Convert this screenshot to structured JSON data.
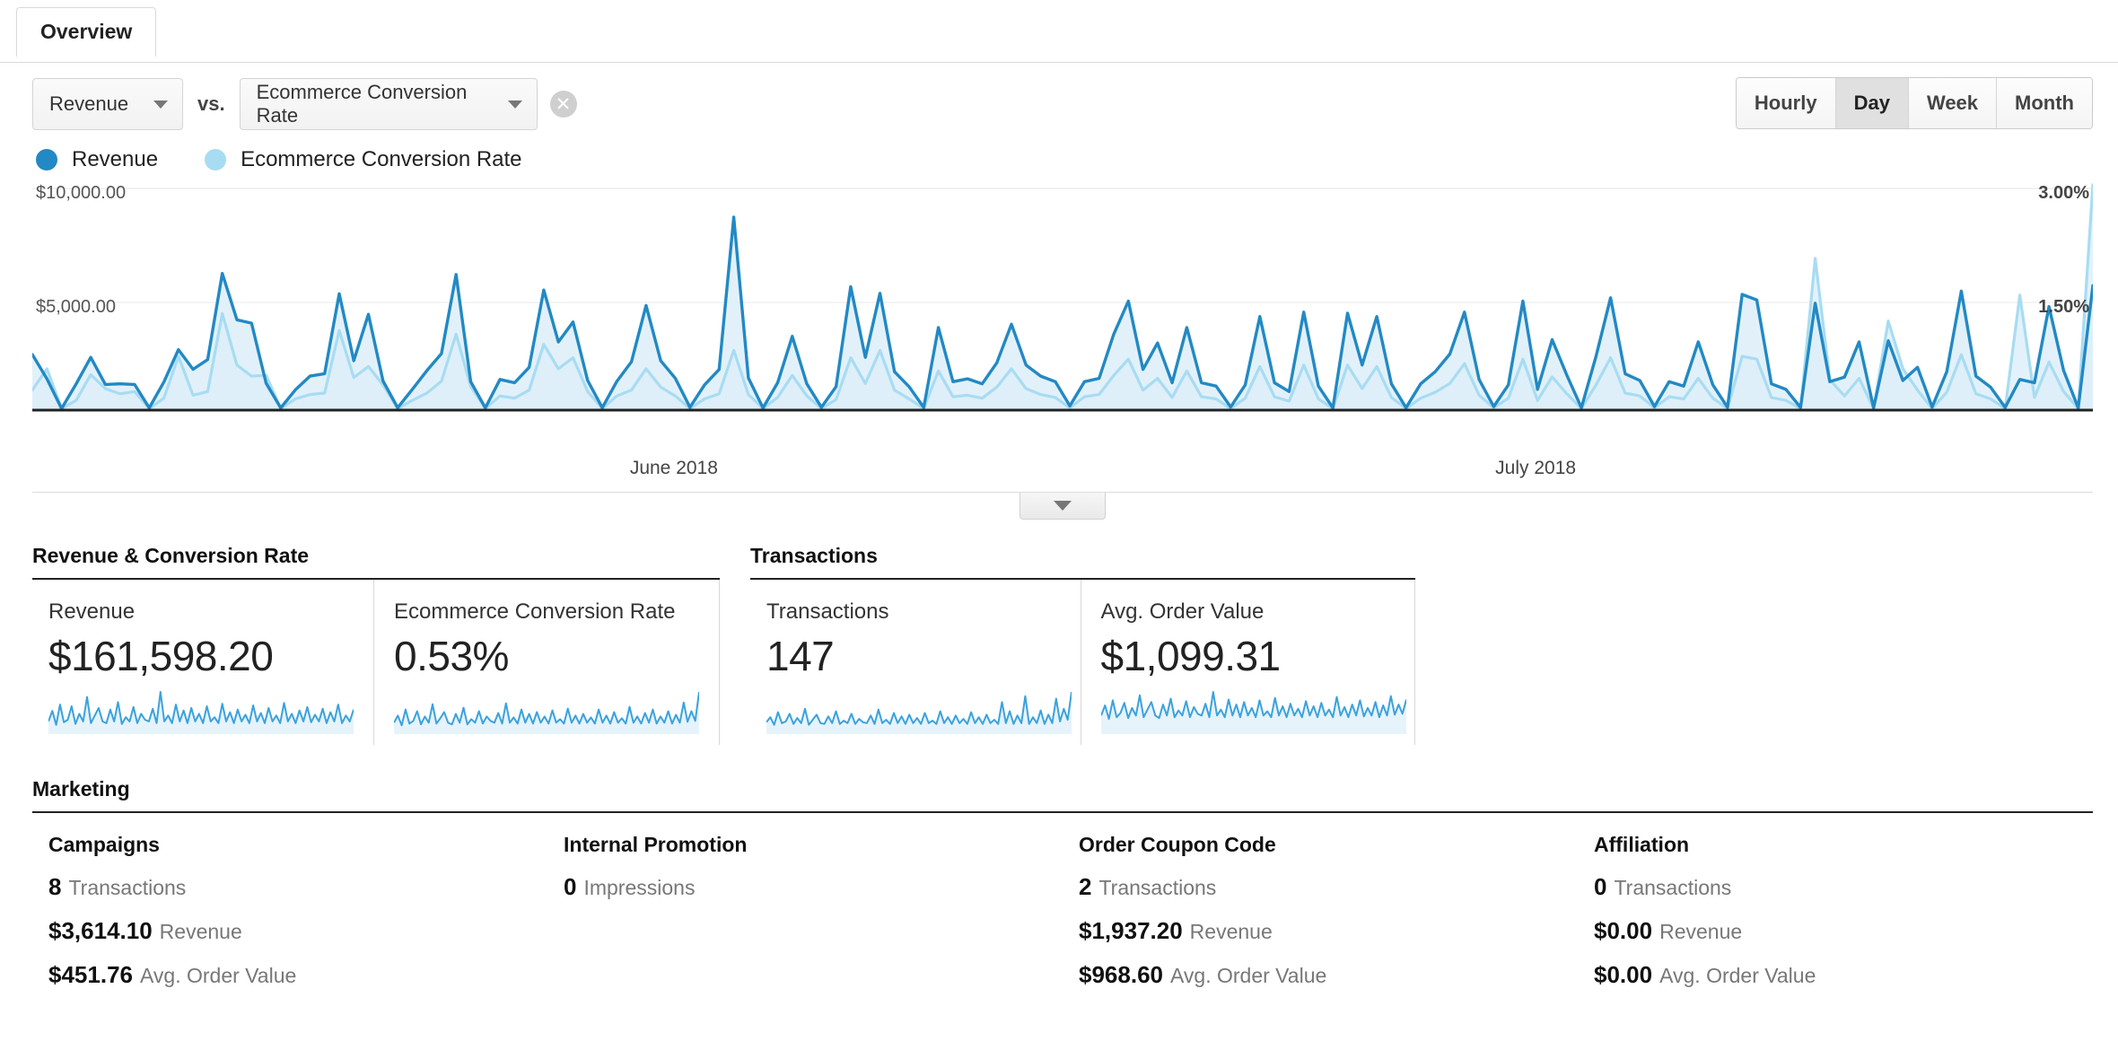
{
  "tabs": [
    {
      "label": "Overview",
      "active": true
    }
  ],
  "controls": {
    "primary_metric": "Revenue",
    "vs_label": "vs.",
    "secondary_metric": "Ecommerce Conversion Rate",
    "remove_icon": "close-circle-icon",
    "caret_icon": "chevron-down-icon",
    "granularity": [
      {
        "label": "Hourly",
        "selected": false
      },
      {
        "label": "Day",
        "selected": true
      },
      {
        "label": "Week",
        "selected": false
      },
      {
        "label": "Month",
        "selected": false
      }
    ]
  },
  "legend": [
    {
      "label": "Revenue",
      "color": "#2289c4"
    },
    {
      "label": "Ecommerce Conversion Rate",
      "color": "#a8dcf2"
    }
  ],
  "chart_data": {
    "type": "line",
    "title": "",
    "xlabel": "",
    "ylabel": "Revenue",
    "y2label": "Ecommerce Conversion Rate",
    "grid": true,
    "legend_position": "top-left",
    "ylim": [
      0,
      10000
    ],
    "y2lim": [
      0,
      3
    ],
    "ytick_labels": [
      "$10,000.00",
      "$5,000.00"
    ],
    "y2tick_labels": [
      "3.00%",
      "1.50%"
    ],
    "xtick_labels": [
      "June 2018",
      "July 2018"
    ],
    "collapse_icon": "chevron-down-icon",
    "series": [
      {
        "name": "Revenue",
        "color": "#2289c4",
        "axis": "left",
        "values": [
          2480,
          1380,
          30,
          1150,
          2350,
          1120,
          1150,
          1120,
          60,
          1230,
          2700,
          1810,
          2250,
          6150,
          4050,
          3900,
          1180,
          60,
          880,
          1500,
          1610,
          5230,
          2200,
          4300,
          1280,
          70,
          900,
          1750,
          2520,
          6100,
          1250,
          60,
          1350,
          1200,
          1900,
          5400,
          3050,
          3950,
          1300,
          70,
          1260,
          2150,
          4700,
          2200,
          1400,
          90,
          1100,
          1800,
          8700,
          1420,
          60,
          1200,
          3300,
          1150,
          90,
          1020,
          5550,
          2350,
          5250,
          1700,
          1020,
          80,
          3700,
          1250,
          1380,
          1150,
          2100,
          3850,
          2000,
          1500,
          1250,
          150,
          1250,
          1400,
          3400,
          4900,
          1800,
          3000,
          1200,
          3700,
          1200,
          1050,
          100,
          1100,
          4200,
          1200,
          800,
          4400,
          1050,
          60,
          4350,
          2000,
          4200,
          1150,
          70,
          1150,
          1700,
          2500,
          4400,
          1350,
          120,
          1100,
          4900,
          900,
          3150,
          1550,
          70,
          2400,
          5050,
          1600,
          1300,
          120,
          1250,
          1050,
          3050,
          1100,
          90,
          5200,
          4950,
          1150,
          900,
          80,
          4800,
          1250,
          1450,
          3050,
          60,
          3100,
          1300,
          1900,
          100,
          1700,
          5350,
          1500,
          1000,
          80,
          1350,
          1200,
          4650,
          1750,
          60,
          5600
        ]
      },
      {
        "name": "Ecommerce Conversion Rate",
        "color": "#a8dcf2",
        "axis": "right",
        "values": [
          0.26,
          0.55,
          0.01,
          0.12,
          0.47,
          0.28,
          0.21,
          0.24,
          0.01,
          0.15,
          0.72,
          0.19,
          0.24,
          1.3,
          0.6,
          0.45,
          0.46,
          0.01,
          0.14,
          0.2,
          0.22,
          1.07,
          0.43,
          0.58,
          0.33,
          0.01,
          0.12,
          0.22,
          0.38,
          1.02,
          0.31,
          0.01,
          0.18,
          0.15,
          0.26,
          0.88,
          0.55,
          0.7,
          0.24,
          0.01,
          0.18,
          0.26,
          0.55,
          0.3,
          0.18,
          0.01,
          0.14,
          0.21,
          0.8,
          0.2,
          0.01,
          0.16,
          0.46,
          0.18,
          0.01,
          0.13,
          0.7,
          0.35,
          0.8,
          0.26,
          0.14,
          0.01,
          0.52,
          0.17,
          0.19,
          0.15,
          0.3,
          0.55,
          0.28,
          0.2,
          0.16,
          0.02,
          0.17,
          0.2,
          0.46,
          0.68,
          0.26,
          0.42,
          0.16,
          0.52,
          0.17,
          0.14,
          0.01,
          0.15,
          0.58,
          0.17,
          0.11,
          0.6,
          0.14,
          0.01,
          0.6,
          0.28,
          0.58,
          0.16,
          0.01,
          0.15,
          0.23,
          0.35,
          0.62,
          0.19,
          0.02,
          0.15,
          0.68,
          0.12,
          0.44,
          0.21,
          0.01,
          0.33,
          0.7,
          0.22,
          0.18,
          0.02,
          0.17,
          0.14,
          0.42,
          0.15,
          0.01,
          0.72,
          0.68,
          0.16,
          0.12,
          0.01,
          2.05,
          0.4,
          0.18,
          0.42,
          0.01,
          1.2,
          0.55,
          0.26,
          0.01,
          0.23,
          0.74,
          0.21,
          0.14,
          0.01,
          1.55,
          0.16,
          0.64,
          0.24,
          0.01,
          3.05
        ]
      }
    ]
  },
  "sections": [
    {
      "title": "Revenue & Conversion Rate",
      "cards": [
        {
          "label": "Revenue",
          "value": "$161,598.20"
        },
        {
          "label": "Ecommerce Conversion Rate",
          "value": "0.53%"
        }
      ]
    },
    {
      "title": "Transactions",
      "cards": [
        {
          "label": "Transactions",
          "value": "147"
        },
        {
          "label": "Avg. Order Value",
          "value": "$1,099.31"
        }
      ]
    }
  ],
  "marketing": {
    "title": "Marketing",
    "columns": [
      {
        "title": "Campaigns",
        "stats": [
          {
            "value": "8",
            "unit": "Transactions"
          },
          {
            "value": "$3,614.10",
            "unit": "Revenue"
          },
          {
            "value": "$451.76",
            "unit": "Avg. Order Value"
          }
        ]
      },
      {
        "title": "Internal Promotion",
        "stats": [
          {
            "value": "0",
            "unit": "Impressions"
          }
        ]
      },
      {
        "title": "Order Coupon Code",
        "stats": [
          {
            "value": "2",
            "unit": "Transactions"
          },
          {
            "value": "$1,937.20",
            "unit": "Revenue"
          },
          {
            "value": "$968.60",
            "unit": "Avg. Order Value"
          }
        ]
      },
      {
        "title": "Affiliation",
        "stats": [
          {
            "value": "0",
            "unit": "Transactions"
          },
          {
            "value": "$0.00",
            "unit": "Revenue"
          },
          {
            "value": "$0.00",
            "unit": "Avg. Order Value"
          }
        ]
      }
    ]
  },
  "sparklines": {
    "revenue": [
      30,
      55,
      22,
      70,
      28,
      34,
      66,
      24,
      48,
      30,
      88,
      26,
      44,
      62,
      30,
      26,
      58,
      30,
      76,
      24,
      40,
      30,
      64,
      26,
      48,
      34,
      30,
      60,
      26,
      100,
      30,
      44,
      26,
      70,
      30,
      56,
      26,
      62,
      30,
      48,
      26,
      66,
      30,
      40,
      26,
      72,
      30,
      52,
      26,
      58,
      30,
      46,
      26,
      68,
      30,
      50,
      26,
      62,
      30,
      44,
      26,
      74,
      30,
      48,
      26,
      56,
      30,
      64,
      28,
      46,
      30,
      60,
      26,
      52,
      30,
      70,
      26,
      44,
      30,
      58
    ],
    "conversion": [
      26,
      42,
      20,
      56,
      24,
      30,
      52,
      22,
      40,
      26,
      68,
      24,
      36,
      50,
      26,
      22,
      46,
      26,
      60,
      22,
      34,
      26,
      52,
      24,
      40,
      30,
      26,
      48,
      24,
      70,
      26,
      38,
      24,
      56,
      26,
      46,
      24,
      50,
      26,
      40,
      24,
      54,
      26,
      34,
      24,
      58,
      26,
      42,
      24,
      46,
      26,
      38,
      24,
      56,
      26,
      42,
      24,
      50,
      26,
      36,
      24,
      62,
      26,
      40,
      24,
      48,
      26,
      56,
      24,
      40,
      26,
      52,
      24,
      44,
      26,
      72,
      28,
      52,
      30,
      96
    ],
    "transactions": [
      28,
      40,
      22,
      52,
      26,
      30,
      48,
      24,
      38,
      26,
      60,
      22,
      34,
      46,
      26,
      24,
      42,
      26,
      54,
      24,
      32,
      26,
      48,
      24,
      36,
      28,
      26,
      44,
      24,
      58,
      26,
      34,
      24,
      50,
      26,
      42,
      24,
      46,
      26,
      38,
      24,
      50,
      26,
      32,
      24,
      54,
      26,
      40,
      24,
      44,
      26,
      36,
      24,
      52,
      26,
      40,
      24,
      46,
      26,
      34,
      24,
      76,
      26,
      54,
      24,
      44,
      26,
      90,
      24,
      40,
      26,
      56,
      24,
      46,
      26,
      84,
      30,
      60,
      34,
      100
    ],
    "aov": [
      44,
      68,
      36,
      80,
      40,
      50,
      74,
      38,
      62,
      44,
      92,
      40,
      58,
      76,
      44,
      38,
      70,
      44,
      84,
      40,
      56,
      44,
      78,
      40,
      64,
      48,
      44,
      72,
      40,
      100,
      44,
      58,
      40,
      82,
      44,
      70,
      40,
      76,
      44,
      62,
      40,
      80,
      44,
      54,
      40,
      86,
      44,
      66,
      40,
      72,
      44,
      60,
      40,
      78,
      44,
      66,
      40,
      74,
      44,
      58,
      40,
      88,
      44,
      64,
      40,
      70,
      44,
      80,
      42,
      62,
      44,
      76,
      40,
      68,
      44,
      90,
      46,
      70,
      48,
      82
    ]
  }
}
